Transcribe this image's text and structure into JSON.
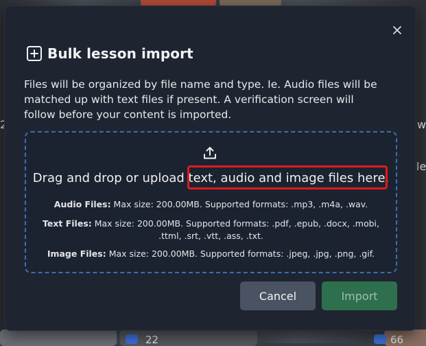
{
  "dialog": {
    "title": "Bulk lesson import",
    "description": "Files will be organized by file name and type. Ie. Audio files will be matched up with text files if present. A verification screen will follow before your content is imported.",
    "close_icon": "close-icon",
    "title_icon": "plus-square-icon"
  },
  "dropzone": {
    "upload_icon": "upload-icon",
    "headline_prefix": "Drag and drop or upload ",
    "headline_highlight": "text, audio and image files here.",
    "audio_label": "Audio Files:",
    "audio_text": " Max size: 200.00MB. Supported formats: .mp3, .m4a, .wav.",
    "text_label": "Text Files:",
    "text_text_line1": " Max size: 200.00MB. Supported formats: .pdf, .epub, .docx, .mobi,",
    "text_text_line2": ".ttml, .srt, .vtt, .ass, .txt.",
    "image_label": "Image Files:",
    "image_text": " Max size: 200.00MB. Supported formats: .jpeg, .jpg, .png, .gif.",
    "highlight_color": "#e01b1b"
  },
  "buttons": {
    "cancel": "Cancel",
    "import": "Import"
  },
  "background": {
    "left_edge_char": "2",
    "right_edge_text_1": "w",
    "right_edge_text_2": "lew",
    "bottom_count_1": "22",
    "bottom_count_2": "66"
  },
  "colors": {
    "modal_bg": "#1f2530",
    "dropzone_border": "#3d6db8",
    "cancel_bg": "#4a5361",
    "import_bg": "#2e6f4e"
  }
}
